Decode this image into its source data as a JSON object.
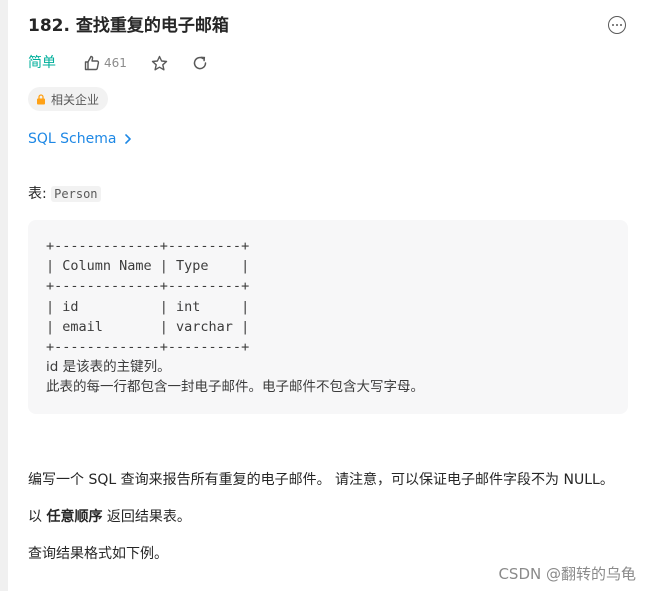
{
  "problem": {
    "title": "182. 查找重复的电子邮箱",
    "difficulty": "简单",
    "like_count": "461",
    "company_tag": "相关企业",
    "schema_link": "SQL Schema"
  },
  "description": {
    "table_label": "表: ",
    "table_name": "Person",
    "schema_table": "+-------------+---------+\n| Column Name | Type    |\n+-------------+---------+\n| id          | int     |\n| email       | varchar |\n+-------------+---------+",
    "schema_note_1": "id 是该表的主键列。",
    "schema_note_2": "此表的每一行都包含一封电子邮件。电子邮件不包含大写字母。",
    "paragraph_1": "编写一个 SQL 查询来报告所有重复的电子邮件。 请注意，可以保证电子邮件字段不为 NULL。",
    "paragraph_2_prefix": "以 ",
    "paragraph_2_bold": "任意顺序",
    "paragraph_2_suffix": " 返回结果表。",
    "paragraph_3": "查询结果格式如下例。"
  },
  "watermark": "CSDN @翻转的乌龟",
  "colors": {
    "difficulty_easy": "#00af9b",
    "link": "#1e88e5",
    "code_background": "#f7f7f8",
    "tag_background": "#f2f2f2",
    "lock_icon": "#ffa116"
  }
}
